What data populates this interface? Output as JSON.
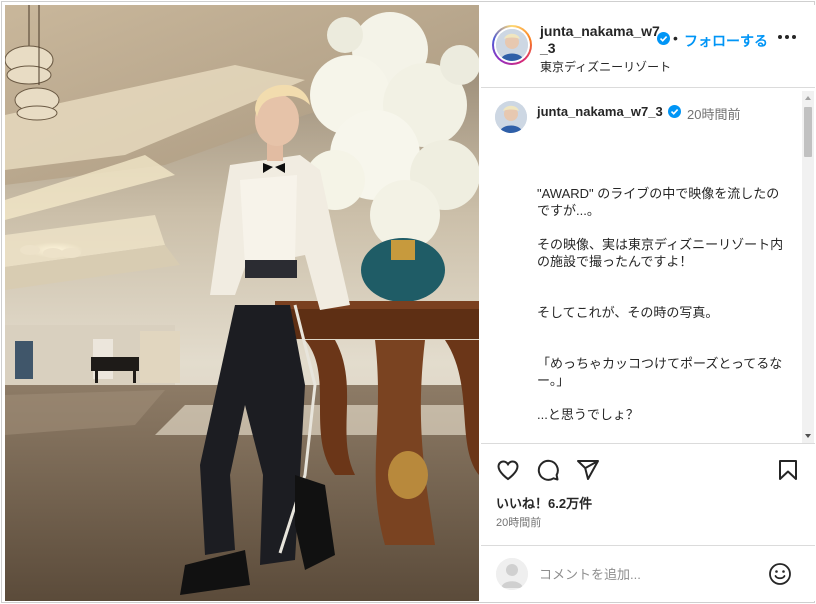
{
  "post": {
    "username": "junta_nakama_w7_3",
    "username_header": "junta_nakama_w7\n_3",
    "follow_label": "フォローする",
    "separator": "•",
    "location": "東京ディズニーリゾート",
    "more_icon": "more-horizontal-icon"
  },
  "caption": {
    "username": "junta_nakama_w7_3",
    "time_ago": "20時間前",
    "lines": [
      "\"AWARD\" のライブの中で映像を流したのですが...。",
      "その映像、実は東京ディズニーリゾート内の施設で撮ったんですよ！",
      "そしてこれが、その時の写真。",
      "「めっちゃカッコつけてポーズとってるなー。」",
      "...と思うでしょ？"
    ]
  },
  "actions": {
    "icons": [
      "heart-icon",
      "comment-icon",
      "share-icon",
      "bookmark-icon"
    ],
    "likes_label": "いいね！6.2万件",
    "posted": "20時間前"
  },
  "comment": {
    "placeholder": "コメントを追加...",
    "emoji_icon": "emoji-icon"
  },
  "colors": {
    "accent": "#0095f6",
    "verified": "#0095f6",
    "border": "#dbdbdb"
  }
}
